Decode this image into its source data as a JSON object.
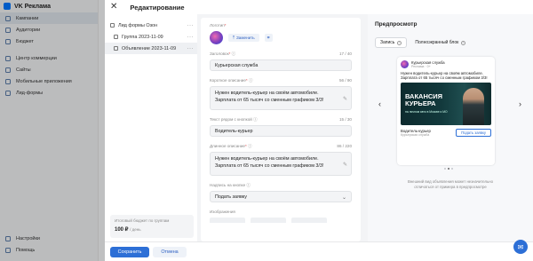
{
  "app": {
    "brand": "VK Реклама",
    "nav": [
      {
        "label": "Кампании",
        "icon": "campaigns-icon",
        "active": true
      },
      {
        "label": "Аудитории",
        "icon": "audiences-icon"
      },
      {
        "label": "Бюджет",
        "icon": "budget-icon"
      }
    ],
    "nav2": [
      {
        "label": "Центр коммерции",
        "icon": "commerce-icon"
      },
      {
        "label": "Сайты",
        "icon": "sites-icon"
      },
      {
        "label": "Мобильные приложения",
        "icon": "mobile-apps-icon"
      },
      {
        "label": "Лид-формы",
        "icon": "lead-forms-icon"
      }
    ],
    "nav_bottom": [
      {
        "label": "Настройки",
        "icon": "settings-icon"
      },
      {
        "label": "Помощь",
        "icon": "help-icon"
      }
    ]
  },
  "modal": {
    "title": "Редактирование",
    "tree": [
      {
        "label": "Лид формы Озон",
        "level": 0
      },
      {
        "label": "Группа 2023-11-09",
        "level": 1
      },
      {
        "label": "Объявление 2023-11-09",
        "level": 2,
        "selected": true
      }
    ],
    "budget": {
      "label": "Итоговый бюджет по группам",
      "value": "100 ₽",
      "unit": "/ день"
    },
    "form": {
      "logo_label": "Логотип",
      "replace_btn": "Заменить",
      "headline": {
        "label": "Заголовок",
        "counter": "17 / 40",
        "value": "Курьерская служба"
      },
      "short_desc": {
        "label": "Короткое описание",
        "counter": "56 / 90",
        "value": "Нужен водитель-курьер на своём автомобиле. Зарплата от 65 тысяч со сменным графиком 3/3!"
      },
      "button_text": {
        "label": "Текст рядом с кнопкой",
        "counter": "15 / 30",
        "value": "Водитель-курьер"
      },
      "long_desc": {
        "label": "Длинное описание",
        "counter": "86 / 220",
        "value": "Нужен водитель-курьер на своём автомобиле. Зарплата от 65 тысяч со сменным графиком 3/3!"
      },
      "cta": {
        "label": "Надпись на кнопке",
        "value": "Подать заявку"
      },
      "images_label": "Изображения"
    },
    "preview": {
      "title": "Предпросмотр",
      "tabs": [
        {
          "label": "Запись",
          "active": true
        },
        {
          "label": "Полноэкранный блок",
          "active": false
        }
      ],
      "card": {
        "name": "Курьерская служба",
        "sub": "Реклама · 0+",
        "text": "Нужен водитель-курьер на своём автомобиле. Зарплата от 65 тысяч со сменным графиком 3/3!",
        "image_title": "ВАКАНСИЯ КУРЬЕРА",
        "image_sub": "на личном авто в Москве и МО",
        "foot_name": "Водитель-курьер",
        "foot_sub": "Курьерская служба",
        "button": "Подать заявку"
      },
      "note": "Внешний вид объявления может незначительно отличаться от примера в предпросмотре"
    },
    "footer": {
      "save": "Сохранить",
      "cancel": "Отмена"
    }
  }
}
